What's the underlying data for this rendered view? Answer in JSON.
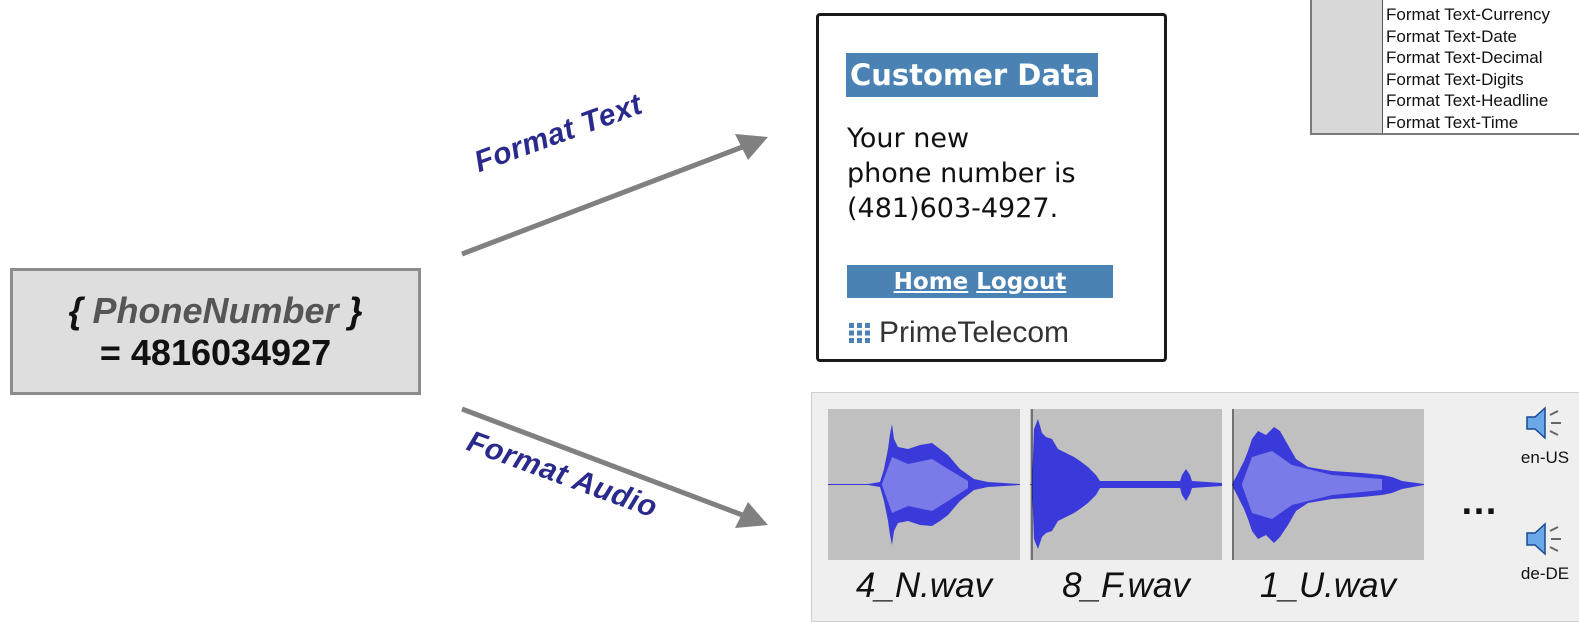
{
  "variable": {
    "name": "PhoneNumber",
    "brace_open": "{",
    "brace_close": "}",
    "value_line": "= 4816034927"
  },
  "arrows": {
    "text_label": "Format Text",
    "audio_label": "Format Audio"
  },
  "phone": {
    "title": "Customer Data",
    "message_lines": [
      "Your new",
      "phone number is",
      "(481)603-4927."
    ],
    "nav": {
      "home": "Home",
      "logout": "Logout"
    },
    "brand": "PrimeTelecom"
  },
  "format_list": {
    "items": [
      "Format Text-Currency",
      "Format Text-Date",
      "Format Text-Decimal",
      "Format Text-Digits",
      "Format Text-Headline",
      "Format Text-Time"
    ]
  },
  "audio": {
    "files": [
      "4_N.wav",
      "8_F.wav",
      "1_U.wav"
    ],
    "ellipsis": "…",
    "locales": [
      "en-US",
      "de-DE"
    ]
  },
  "colors": {
    "arrow": "#808080",
    "label": "#2a2a8c",
    "header_bg": "#4a82b4",
    "wave": "#3a3adb",
    "wave_bg": "#c0c0c0"
  },
  "icons": {
    "brand": "dots-grid-icon",
    "locale": "speaker-icon"
  }
}
